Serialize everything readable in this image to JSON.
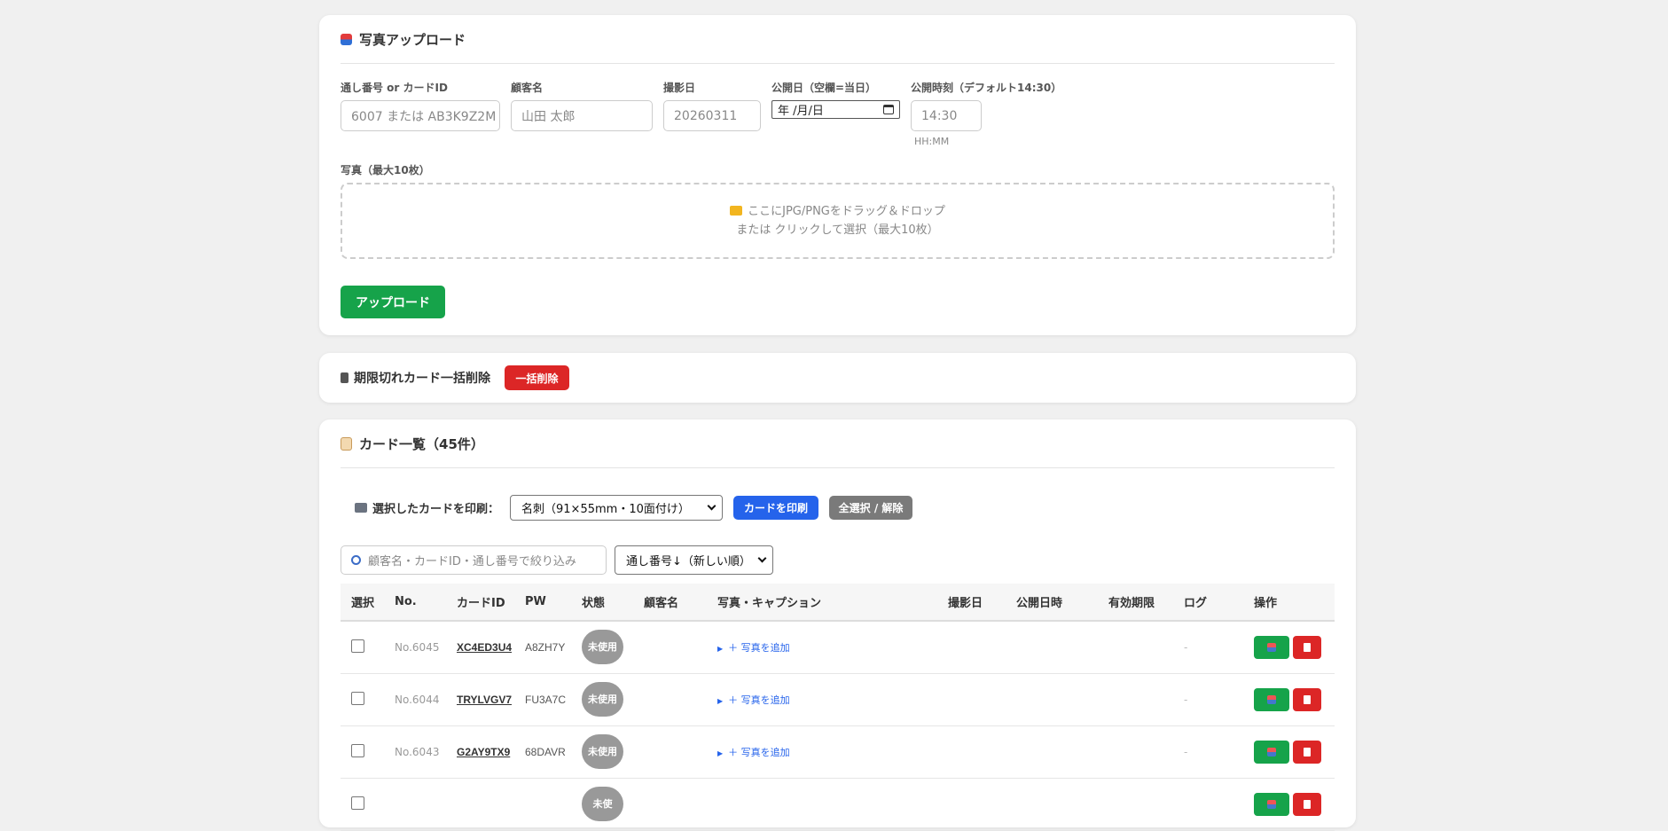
{
  "upload": {
    "title": "写真アップロード",
    "fields": {
      "serial_label": "通し番号 or カードID",
      "serial_placeholder": "6007 または AB3K9Z2M",
      "customer_label": "顧客名",
      "customer_placeholder": "山田 太郎",
      "shoot_label": "撮影日",
      "shoot_placeholder": "20260311",
      "pub_date_label": "公開日（空欄=当日）",
      "pub_date_value": "年 /月/日",
      "pub_time_label": "公開時刻（デフォルト14:30）",
      "pub_time_placeholder": "14:30",
      "pub_time_hint": "HH:MM"
    },
    "photos_label": "写真（最大10枚）",
    "drop_line1": "ここにJPG/PNGをドラッグ＆ドロップ",
    "drop_line2": "または クリックして選択（最大10枚）",
    "upload_button": "アップロード"
  },
  "expired": {
    "title": "期限切れカード一括削除",
    "button": "一括削除"
  },
  "cards": {
    "title": "カード一覧（45件）",
    "print_label": "選択したカードを印刷：",
    "print_format": "名刺（91×55mm・10面付け）",
    "print_button": "カードを印刷",
    "select_all_button": "全選択 / 解除",
    "search_placeholder": "顧客名・カードID・通し番号で絞り込み",
    "sort_value": "通し番号↓（新しい順）",
    "columns": [
      "選択",
      "No.",
      "カードID",
      "PW",
      "状態",
      "顧客名",
      "写真・キャプション",
      "撮影日",
      "公開日時",
      "有効期限",
      "ログ",
      "操作"
    ],
    "rows": [
      {
        "no": "No.6045",
        "card_id": "XC4ED3U4",
        "pw": "A8ZH7Y",
        "status": "未使用",
        "customer": "",
        "photos": "＋ 写真を追加",
        "shoot": "",
        "pub": "",
        "expiry": "",
        "log": "-"
      },
      {
        "no": "No.6044",
        "card_id": "TRYLVGV7",
        "pw": "FU3A7C",
        "status": "未使用",
        "customer": "",
        "photos": "＋ 写真を追加",
        "shoot": "",
        "pub": "",
        "expiry": "",
        "log": "-"
      },
      {
        "no": "No.6043",
        "card_id": "G2AY9TX9",
        "pw": "68DAVR",
        "status": "未使用",
        "customer": "",
        "photos": "＋ 写真を追加",
        "shoot": "",
        "pub": "",
        "expiry": "",
        "log": "-"
      },
      {
        "no": "",
        "card_id": "",
        "pw": "",
        "status": "未使",
        "customer": "",
        "photos": "",
        "shoot": "",
        "pub": "",
        "expiry": "",
        "log": ""
      }
    ]
  },
  "icons": {
    "upload": "upload-icon",
    "trash": "trash-icon",
    "clipboard": "clipboard-icon",
    "printer": "printer-icon",
    "folder": "folder-icon",
    "search": "search-icon"
  },
  "colors": {
    "green": "#16a34a",
    "red": "#dc2626",
    "blue": "#2563eb",
    "gray": "#7a7a7a",
    "pill": "#999999"
  }
}
